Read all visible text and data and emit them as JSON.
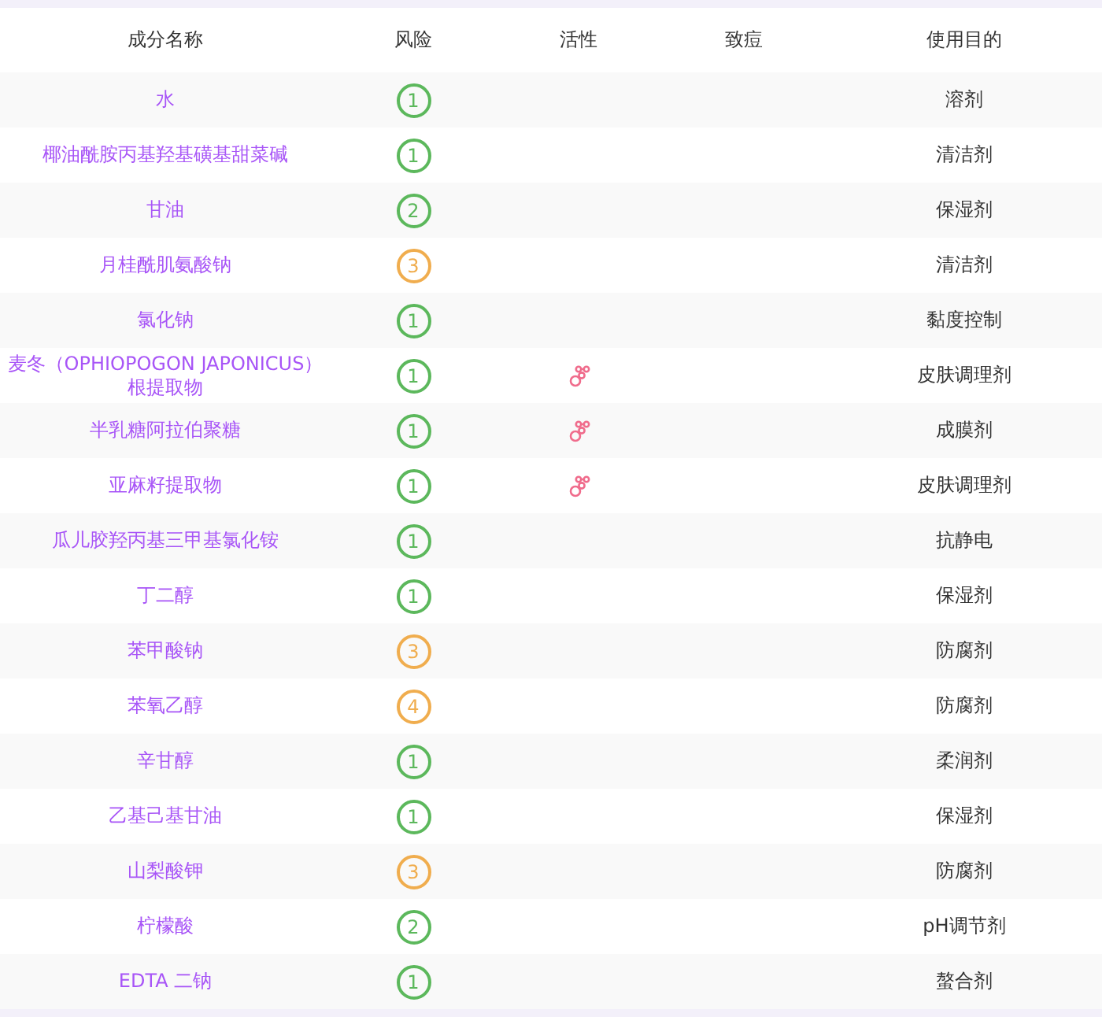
{
  "table": {
    "columns": [
      "成分名称",
      "风险",
      "活性",
      "致痘",
      "使用目的"
    ],
    "rows": [
      {
        "name": "水",
        "risk": "1",
        "color": "#5cb85c",
        "active": false,
        "purpose": "溶剂"
      },
      {
        "name": "椰油酰胺丙基羟基磺基甜菜碱",
        "risk": "1",
        "color": "#5cb85c",
        "active": false,
        "purpose": "清洁剂"
      },
      {
        "name": "甘油",
        "risk": "2",
        "color": "#5cb85c",
        "active": false,
        "purpose": "保湿剂"
      },
      {
        "name": "月桂酰肌氨酸钠",
        "risk": "3",
        "color": "#f0ad4e",
        "active": false,
        "purpose": "清洁剂"
      },
      {
        "name": "氯化钠",
        "risk": "1",
        "color": "#5cb85c",
        "active": false,
        "purpose": "黏度控制"
      },
      {
        "name": "麦冬（OPHIOPOGON JAPONICUS）根提取物",
        "risk": "1",
        "color": "#5cb85c",
        "active": true,
        "purpose": "皮肤调理剂"
      },
      {
        "name": "半乳糖阿拉伯聚糖",
        "risk": "1",
        "color": "#5cb85c",
        "active": true,
        "purpose": "成膜剂"
      },
      {
        "name": "亚麻籽提取物",
        "risk": "1",
        "color": "#5cb85c",
        "active": true,
        "purpose": "皮肤调理剂"
      },
      {
        "name": "瓜儿胶羟丙基三甲基氯化铵",
        "risk": "1",
        "color": "#5cb85c",
        "active": false,
        "purpose": "抗静电"
      },
      {
        "name": "丁二醇",
        "risk": "1",
        "color": "#5cb85c",
        "active": false,
        "purpose": "保湿剂"
      },
      {
        "name": "苯甲酸钠",
        "risk": "3",
        "color": "#f0ad4e",
        "active": false,
        "purpose": "防腐剂"
      },
      {
        "name": "苯氧乙醇",
        "risk": "4",
        "color": "#f0ad4e",
        "active": false,
        "purpose": "防腐剂"
      },
      {
        "name": "辛甘醇",
        "risk": "1",
        "color": "#5cb85c",
        "active": false,
        "purpose": "柔润剂"
      },
      {
        "name": "乙基己基甘油",
        "risk": "1",
        "color": "#5cb85c",
        "active": false,
        "purpose": "保湿剂"
      },
      {
        "name": "山梨酸钾",
        "risk": "3",
        "color": "#f0ad4e",
        "active": false,
        "purpose": "防腐剂"
      },
      {
        "name": "柠檬酸",
        "risk": "2",
        "color": "#5cb85c",
        "active": false,
        "purpose": "pH调节剂"
      },
      {
        "name": "EDTA 二钠",
        "risk": "1",
        "color": "#5cb85c",
        "active": false,
        "purpose": "螯合剂"
      }
    ]
  }
}
